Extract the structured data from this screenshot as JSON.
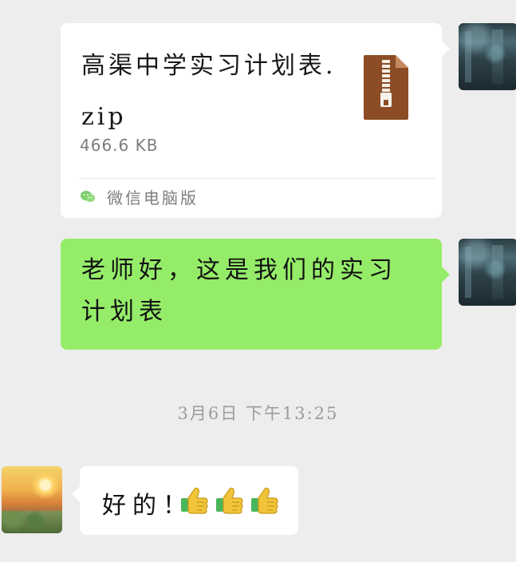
{
  "file_message": {
    "filename": "高渠中学实习计划表.zip",
    "size": "466.6 KB",
    "source": "微信电脑版"
  },
  "text_message": {
    "text": "老师好，这是我们的实习计划表"
  },
  "timestamp": "3月6日 下午13:25",
  "reply_message": {
    "text": "好的！",
    "emoji_count": 3
  },
  "colors": {
    "background": "#ededed",
    "sent_bubble": "#95ec69",
    "received_bubble": "#ffffff",
    "zip_icon": "#8c4c25"
  }
}
